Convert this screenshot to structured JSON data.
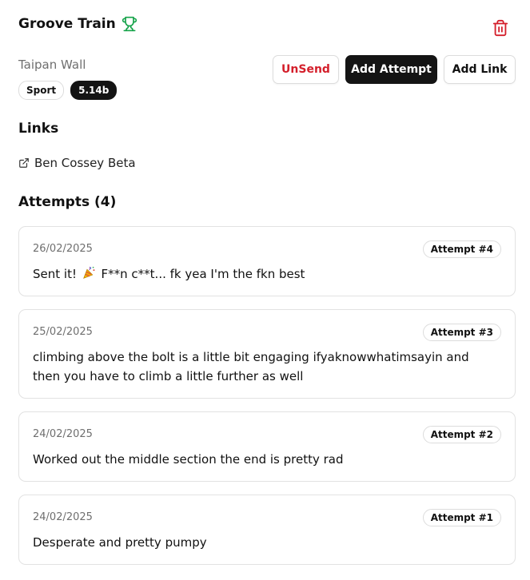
{
  "route": {
    "name": "Groove Train",
    "location": "Taipan Wall",
    "style": "Sport",
    "grade": "5.14b"
  },
  "actions": {
    "unsend": "UnSend",
    "add_attempt": "Add Attempt",
    "add_link": "Add Link"
  },
  "links": {
    "heading": "Links",
    "items": [
      {
        "label": "Ben Cossey Beta"
      }
    ]
  },
  "attempts": {
    "heading": "Attempts (4)",
    "items": [
      {
        "date": "26/02/2025",
        "label": "Attempt #4",
        "note_before": "Sent it! ",
        "note_after": " F**n c**t... fk yea I'm the fkn best",
        "emoji": "party-popper"
      },
      {
        "date": "25/02/2025",
        "label": "Attempt #3",
        "note": "climbing above the bolt is a little bit engaging ifyaknowwhatimsayin and then you have to climb a little further as well"
      },
      {
        "date": "24/02/2025",
        "label": "Attempt #2",
        "note": "Worked out the middle section the end is pretty rad"
      },
      {
        "date": "24/02/2025",
        "label": "Attempt #1",
        "note": "Desperate and pretty pumpy"
      }
    ]
  },
  "icons": [
    "trophy-icon",
    "trash-icon",
    "external-link-icon",
    "party-popper-emoji"
  ],
  "colors": {
    "trophy": "#16a34a",
    "danger": "#d41f2b",
    "primary": "#141414"
  }
}
